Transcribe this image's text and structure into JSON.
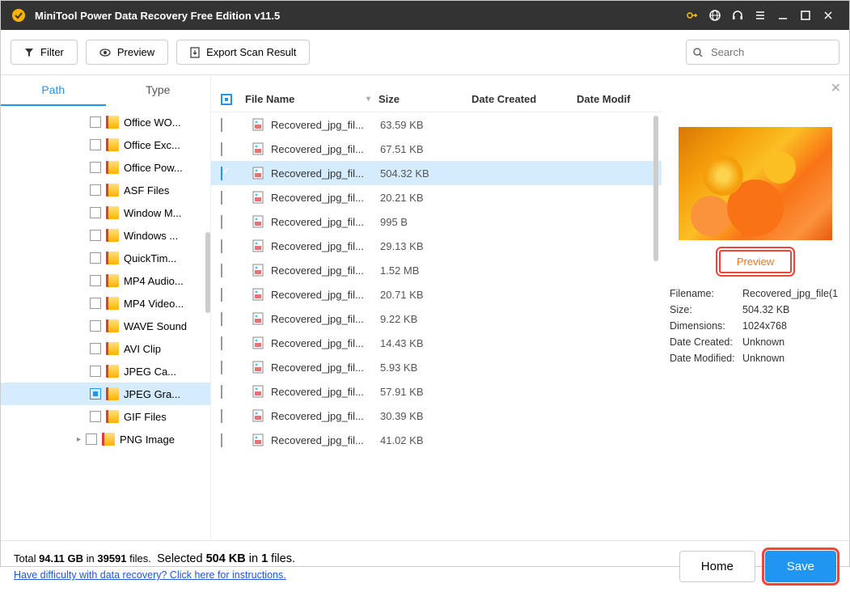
{
  "title": "MiniTool Power Data Recovery Free Edition v11.5",
  "toolbar": {
    "filter": "Filter",
    "preview": "Preview",
    "export": "Export Scan Result",
    "search_placeholder": "Search"
  },
  "tabs": {
    "path": "Path",
    "type": "Type"
  },
  "tree": [
    {
      "label": "Office WO..."
    },
    {
      "label": "Office Exc..."
    },
    {
      "label": "Office Pow..."
    },
    {
      "label": "ASF Files"
    },
    {
      "label": "Window M..."
    },
    {
      "label": "Windows ..."
    },
    {
      "label": "QuickTim..."
    },
    {
      "label": "MP4 Audio..."
    },
    {
      "label": "MP4 Video..."
    },
    {
      "label": "WAVE Sound"
    },
    {
      "label": "AVI Clip"
    },
    {
      "label": "JPEG Ca..."
    },
    {
      "label": "JPEG Gra...",
      "selected": true
    },
    {
      "label": "GIF Files"
    },
    {
      "label": "PNG Image",
      "expandable": true
    }
  ],
  "columns": {
    "name": "File Name",
    "size": "Size",
    "created": "Date Created",
    "modified": "Date Modif"
  },
  "files": [
    {
      "name": "Recovered_jpg_fil...",
      "size": "63.59 KB"
    },
    {
      "name": "Recovered_jpg_fil...",
      "size": "67.51 KB"
    },
    {
      "name": "Recovered_jpg_fil...",
      "size": "504.32 KB",
      "selected": true
    },
    {
      "name": "Recovered_jpg_fil...",
      "size": "20.21 KB"
    },
    {
      "name": "Recovered_jpg_fil...",
      "size": "995 B"
    },
    {
      "name": "Recovered_jpg_fil...",
      "size": "29.13 KB"
    },
    {
      "name": "Recovered_jpg_fil...",
      "size": "1.52 MB"
    },
    {
      "name": "Recovered_jpg_fil...",
      "size": "20.71 KB"
    },
    {
      "name": "Recovered_jpg_fil...",
      "size": "9.22 KB"
    },
    {
      "name": "Recovered_jpg_fil...",
      "size": "14.43 KB"
    },
    {
      "name": "Recovered_jpg_fil...",
      "size": "5.93 KB"
    },
    {
      "name": "Recovered_jpg_fil...",
      "size": "57.91 KB"
    },
    {
      "name": "Recovered_jpg_fil...",
      "size": "30.39 KB"
    },
    {
      "name": "Recovered_jpg_fil...",
      "size": "41.02 KB"
    }
  ],
  "preview": {
    "btn": "Preview",
    "meta": {
      "filename_k": "Filename:",
      "filename_v": "Recovered_jpg_file(1",
      "size_k": "Size:",
      "size_v": "504.32 KB",
      "dim_k": "Dimensions:",
      "dim_v": "1024x768",
      "created_k": "Date Created:",
      "created_v": "Unknown",
      "modified_k": "Date Modified:",
      "modified_v": "Unknown"
    }
  },
  "footer": {
    "total_prefix": "Total ",
    "total_size": "94.11 GB",
    "total_mid": " in ",
    "total_files": "39591",
    "total_suffix": " files.",
    "sel_prefix": "Selected ",
    "sel_size": "504 KB",
    "sel_mid": " in ",
    "sel_files": "1",
    "sel_suffix": " files.",
    "help": "Have difficulty with data recovery? Click here for instructions.",
    "home": "Home",
    "save": "Save"
  }
}
